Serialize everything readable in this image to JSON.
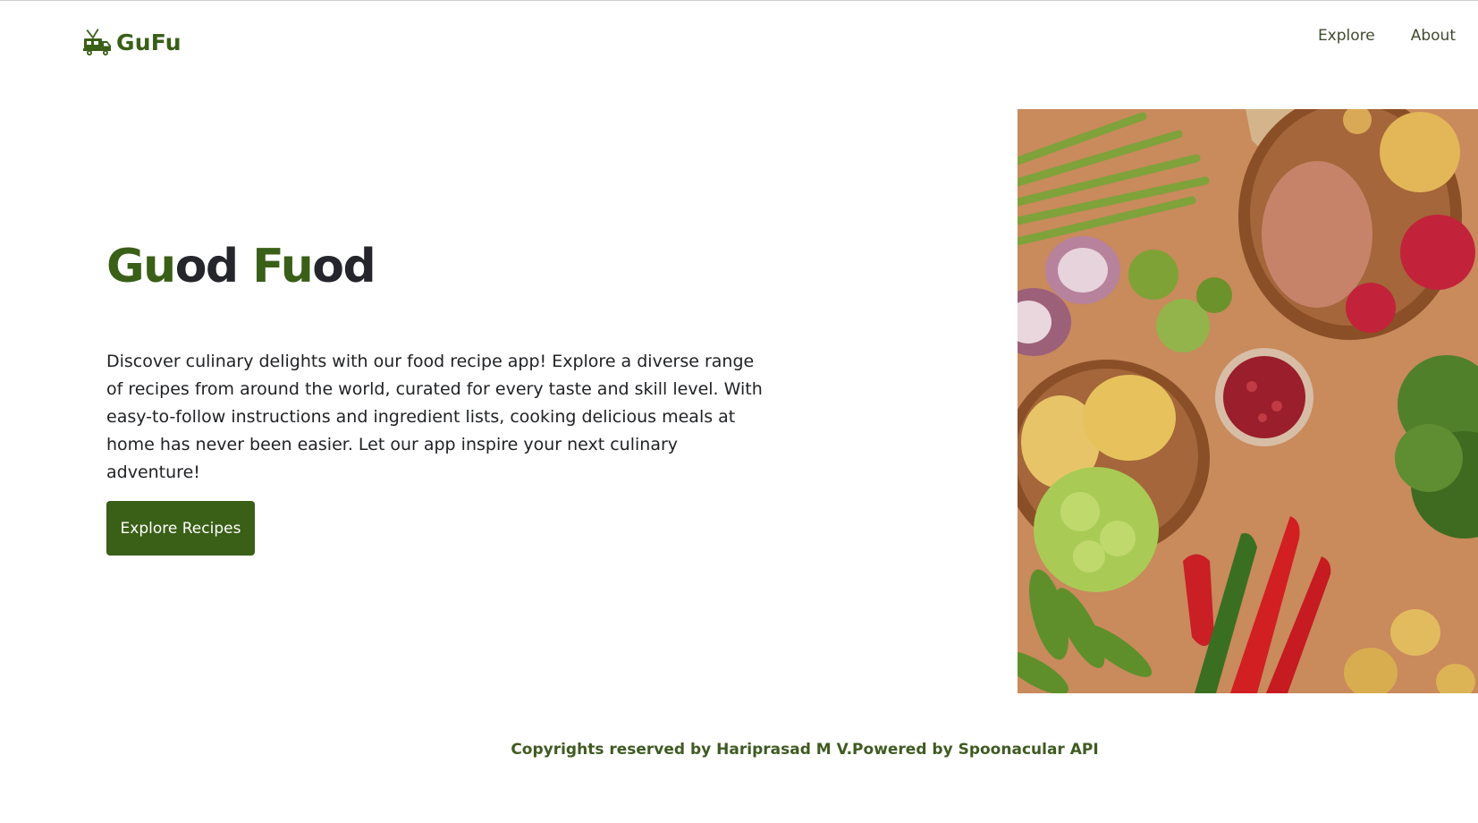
{
  "header": {
    "logo_text": "GuFu",
    "nav": [
      {
        "label": "Explore"
      },
      {
        "label": "About"
      }
    ]
  },
  "hero": {
    "title_parts": [
      "Gu",
      "od ",
      "Fu",
      "od"
    ],
    "description": "Discover culinary delights with our food recipe app! Explore a diverse range of recipes from around the world, curated for every taste and skill level. With easy-to-follow instructions and ingredient lists, cooking delicious meals at home has never been easier. Let our app inspire your next culinary adventure!",
    "cta_label": "Explore Recipes",
    "image_icon": "vegetables-photo"
  },
  "footer": {
    "text": "Copyrights reserved by Hariprasad M V.Powered by Spoonacular API"
  },
  "colors": {
    "brand_green": "#3a5f17",
    "text_dark": "#24262b",
    "image_background": "#c98a5c"
  }
}
